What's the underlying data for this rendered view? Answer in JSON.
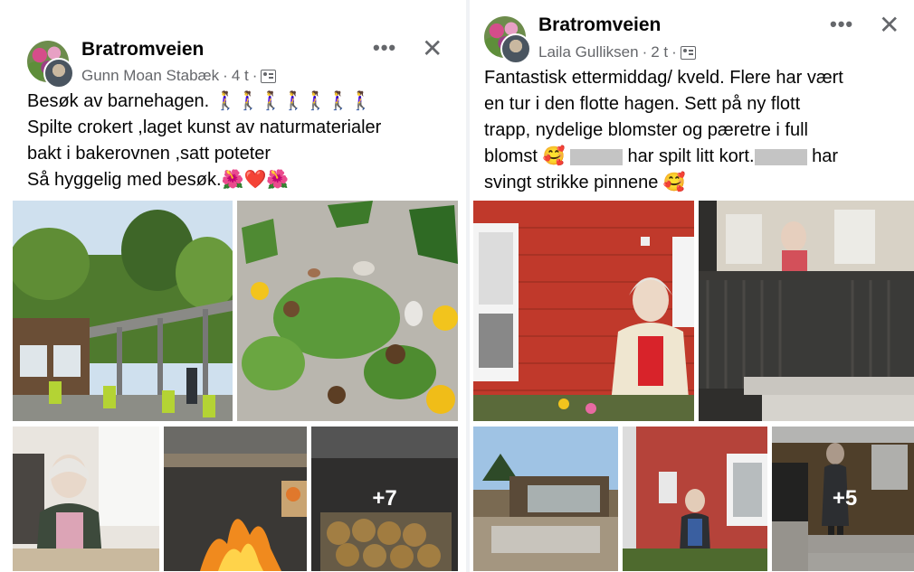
{
  "posts": [
    {
      "group": "Bratromveien",
      "author": "Gunn Moan Stabæk",
      "time": "4 t",
      "menu_icon": "more-horizontal-icon",
      "close_icon": "close-icon",
      "lines": [
        "Besøk av barnehagen. 🚶‍♀️🚶‍♀️🚶‍♀️🚶‍♀️🚶‍♀️🚶‍♀️🚶‍♀️",
        "Spilte crokert ,laget kunst av naturmaterialer",
        "bakt i bakerovnen ,satt poteter",
        "Så hyggelig med besøk.🌺❤️🌺"
      ],
      "more_photos": "+7"
    },
    {
      "group": "Bratromveien",
      "author": "Laila Gulliksen",
      "time": "2 t",
      "menu_icon": "more-horizontal-icon",
      "close_icon": "close-icon",
      "lines": [
        "Fantastisk ettermiddag/ kveld. Flere har vært",
        "en tur i den flotte hagen. Sett på ny flott",
        "trapp, nydelige blomster og pæretre i full"
      ],
      "line4_a": "blomst 🥰 ",
      "line4_b": "har spilt litt kort.",
      "line4_c": "har",
      "line5": "svingt strikke pinnene 🥰",
      "more_photos": "+5"
    }
  ]
}
